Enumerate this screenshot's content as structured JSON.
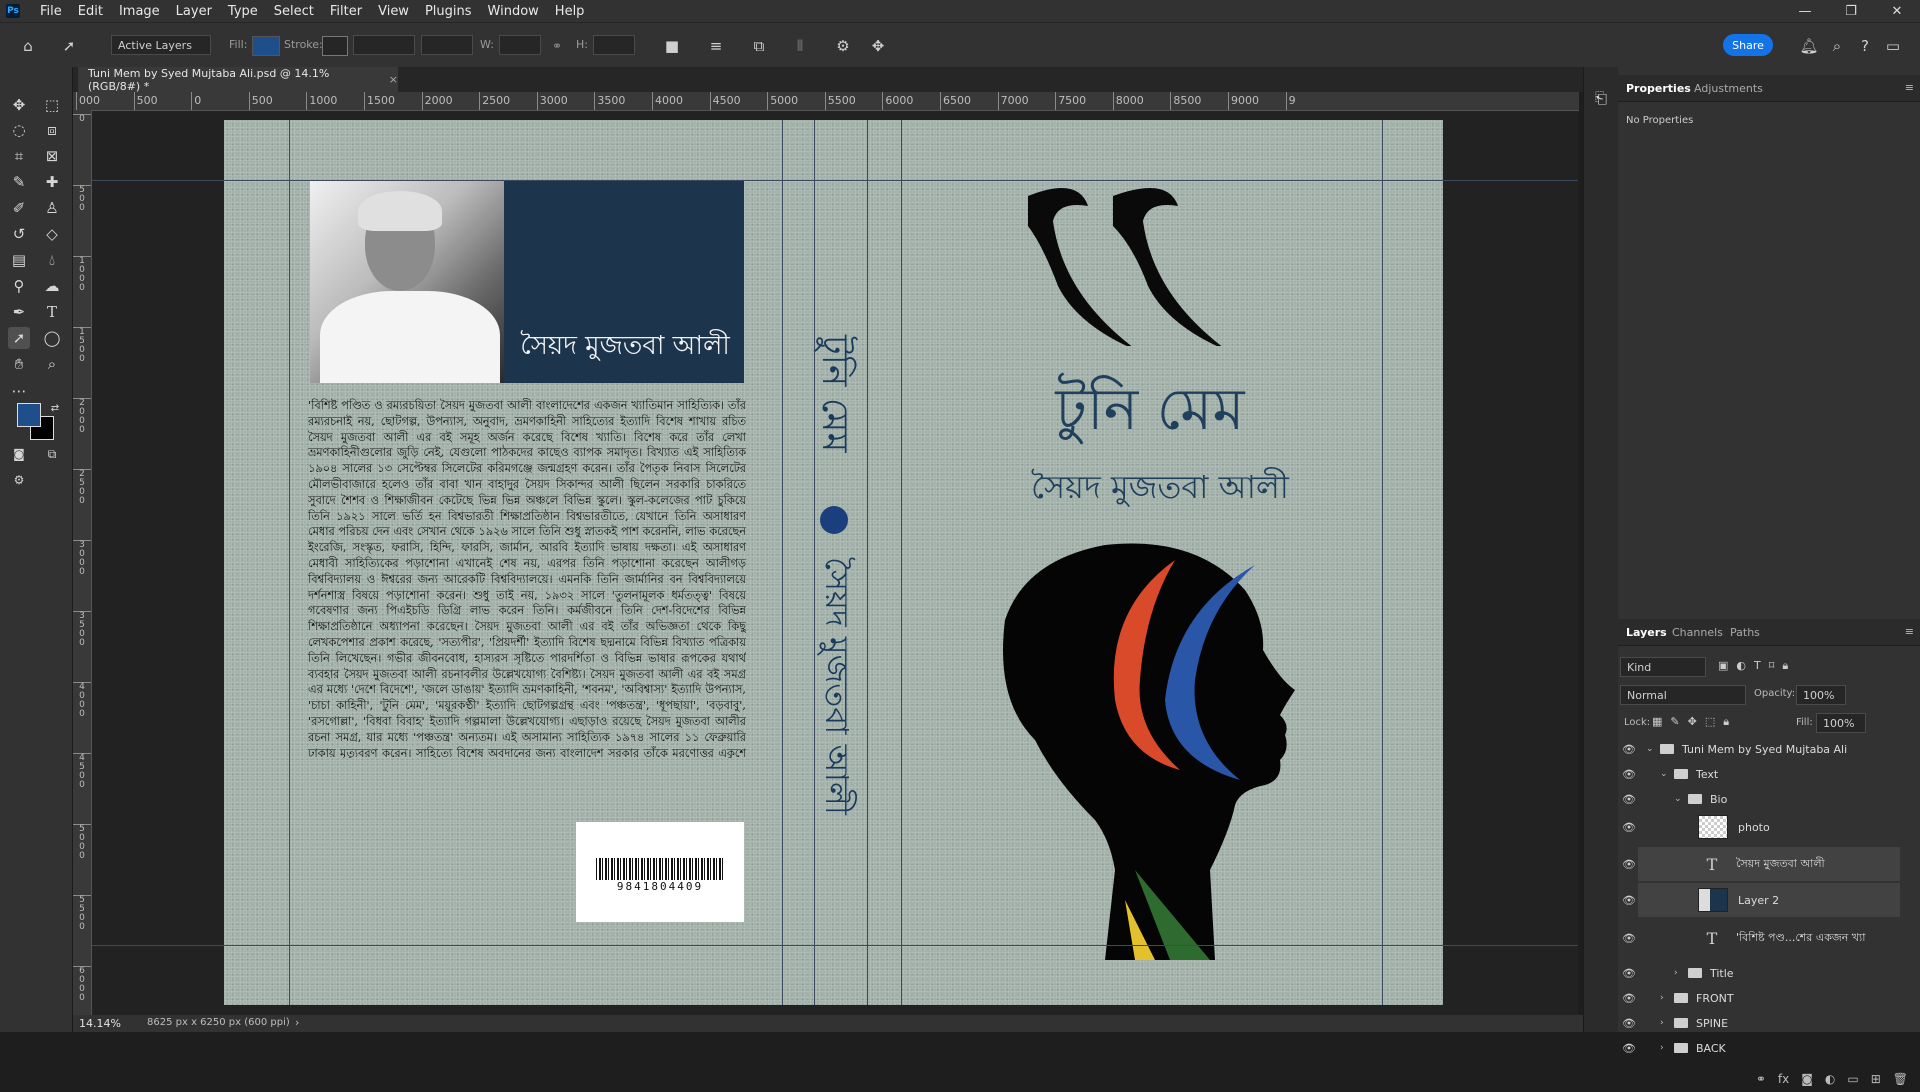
{
  "app": {
    "logo": "Ps"
  },
  "menubar": {
    "items": [
      "File",
      "Edit",
      "Image",
      "Layer",
      "Type",
      "Select",
      "Filter",
      "View",
      "Plugins",
      "Window",
      "Help"
    ]
  },
  "window_controls": {
    "minimize": "—",
    "restore": "❐",
    "close": "✕"
  },
  "optionsbar": {
    "auto_select": "Active Layers",
    "fill_label": "Fill:",
    "stroke_label": "Stroke:",
    "w_label": "W:",
    "h_label": "H:",
    "share_label": "Share"
  },
  "document": {
    "tab_title": "Tuni Mem by Syed Mujtaba Ali.psd @ 14.1% (RGB/8#) *",
    "tab_close": "×",
    "zoom": "14.14%",
    "doc_info": "8625 px x 6250 px (600 ppi)"
  },
  "ruler": {
    "h_labels": [
      "000",
      "500",
      "0",
      "500",
      "1000",
      "1500",
      "2000",
      "2500",
      "3000",
      "3500",
      "4000",
      "4500",
      "5000",
      "5500",
      "6000",
      "6500",
      "7000",
      "7500",
      "8000",
      "8500",
      "9000",
      "9"
    ],
    "v_labels": [
      "0",
      "500",
      "1000",
      "1500",
      "2000",
      "2500",
      "3000",
      "3500",
      "4000",
      "4500",
      "5000",
      "5500",
      "6000"
    ]
  },
  "artwork": {
    "back_author": "সৈয়দ মুজতবা আলী",
    "bio": "'বিশিষ্ট পণ্ডিত ও রম্যরচয়িতা সৈয়দ মুজতবা আলী বাংলাদেশের একজন খ্যাতিমান সাহিত্যিক। তাঁর রম্যরচনাই নয়, ছোটগল্প, উপন্যাস, অনুবাদ, ভ্রমণকাহিনী সাহিত্যের ইত্যাদি বিশেষ শাখায় রচিত সৈয়দ মুজতবা আলী এর বই সমূহ অর্জন করেছে বিশেষ খ্যাতি। বিশেষ করে তাঁর লেখা ভ্রমণকাহিনীগুলোর জুড়ি নেই, যেগুলো পাঠকদের কাছেও ব্যাপক সমাদৃত। বিখ্যাত এই সাহিত্যিক ১৯০৪ সালের ১৩ সেপ্টেম্বর সিলেটের করিমগঞ্জে জন্মগ্রহণ করেন। তাঁর পৈতৃক নিবাস সিলেটের মৌলভীবাজারে হলেও তাঁর বাবা খান বাহাদুর সৈয়দ সিকান্দর আলী ছিলেন সরকারি চাকরিতে সুবাদে শৈশব ও শিক্ষাজীবন কেটেছে ভিন্ন ভিন্ন অঞ্চলে বিভিন্ন স্কুলে। স্কুল-কলেজের পাট চুকিয়ে তিনি ১৯২১ সালে ভর্তি হন বিশ্বভারতী শিক্ষাপ্রতিষ্ঠান বিশ্বভারতীতে, যেখানে তিনি অসাধারণ মেধার পরিচয় দেন এবং সেখান থেকে ১৯২৬ সালে তিনি শুধু স্নাতকই পাশ করেননি, লাভ করেছেন ইংরেজি, সংস্কৃত, ফরাসি, হিন্দি, ফারসি, জার্মান, আরবি ইত্যাদি ভাষায় দক্ষতা। এই অসাধারণ মেধাবী সাহিত্যিকের পড়াশোনা এখানেই শেষ নয়, এরপর তিনি পড়াশোনা করেছেন আলীগড় বিশ্ববিদ্যালয় ও ঈশ্বরের জন্য আরেকটি বিশ্ববিদ্যালয়ে। এমনকি তিনি জার্মানির বন বিশ্ববিদ্যালয়ে দর্শনশাস্ত্র বিষয়ে পড়াশোনা করেন। শুধু তাই নয়, ১৯৩২ সালে 'তুলনামূলক ধর্মতত্ত্ব' বিষয়ে গবেষণার জন্য পিএইচডি ডিগ্রি লাভ করেন তিনি। কর্মজীবনে তিনি দেশ-বিদেশের বিভিন্ন শিক্ষাপ্রতিষ্ঠানে অধ্যাপনা করেছেন। সৈয়দ মুজতবা আলী এর বই তাঁর অভিজ্ঞতা থেকে কিছু লেখকপেশার প্রকাশ করেছে, 'সত্যপীর', 'প্রিয়দর্শী' ইত্যাদি বিশেষ ছদ্মনামে বিভিন্ন বিখ্যাত পত্রিকায় তিনি লিখেছেন। গভীর জীবনবোধ, হাস্যরস সৃষ্টিতে পারদর্শিতা ও বিভিন্ন ভাষার রূপকের যথার্থ ব্যবহার সৈয়দ মুজতবা আলী রচনাবলীর উল্লেখযোগ্য বৈশিষ্ট্য। সৈয়দ মুজতবা আলী এর বই সমগ্র এর মধ্যে 'দেশে বিদেশে', 'জলে ডাঙায়' ইত্যাদি ভ্রমণকাহিনী, 'শবনম', 'অবিশ্বাস্য' ইত্যাদি উপন্যাস, 'চাচা কাহিনী', 'টুনি মেম', 'ময়ূরকণ্ঠী' ইত্যাদি ছোটগল্পগ্রন্থ এবং 'পঞ্চতন্ত্র', 'ধূপছায়া', 'বড়বাবু', 'রসগোল্লা', 'বিধবা বিবাহ' ইত্যাদি গল্পমালা উল্লেখযোগ্য। এছাড়াও রয়েছে সৈয়দ মুজতবা আলীর রচনা সমগ্র, যার মধ্যে 'পঞ্চতন্ত্র' অন্যতম। এই অসামান্য সাহিত্যিক ১৯৭৪ সালের ১১ ফেব্রুয়ারি ঢাকায় মৃত্যুবরণ করেন। সাহিত্যে বিশেষ অবদানের জন্য বাংলাদেশ সরকার তাঁকে মরণোত্তর একুশে পদকে ভূষিত করে",
    "isbn": "9841804409",
    "spine_title": "টুনি মেম",
    "spine_author": "সৈয়দ মুজতবা আলী",
    "front_title": "টুনি মেম",
    "front_author": "সৈয়দ মুজতবা আলী",
    "colors": {
      "cover_bg": "#a2b1a9",
      "navy": "#1c354c",
      "title_blue": "#1f3f5c",
      "red": "#d94a2a",
      "blue": "#2a56a8",
      "green": "#2e6b2e",
      "yellow": "#e3c12c"
    }
  },
  "properties_panel": {
    "tabs": [
      "Properties",
      "Adjustments"
    ],
    "empty_text": "No Properties"
  },
  "layers_panel": {
    "tabs": [
      "Layers",
      "Channels",
      "Paths"
    ],
    "filter_kind": "Kind",
    "blend_mode": "Normal",
    "opacity_label": "Opacity:",
    "opacity": "100%",
    "lock_label": "Lock:",
    "fill_label": "Fill:",
    "fill": "100%",
    "layers": [
      {
        "name": "Tuni Mem by Syed Mujtaba Ali",
        "kind": "group",
        "expanded": true
      },
      {
        "name": "Text",
        "kind": "group",
        "expanded": true
      },
      {
        "name": "Bio",
        "kind": "group",
        "expanded": true
      },
      {
        "name": "photo",
        "kind": "pixel"
      },
      {
        "name": "সৈয়দ মুজতবা আলী",
        "kind": "text",
        "selected": true
      },
      {
        "name": "Layer 2",
        "kind": "pixel",
        "selected": true
      },
      {
        "name": "'বিশিষ্ট পণ্ড...শের একজন খ্যা",
        "kind": "text"
      },
      {
        "name": "Title",
        "kind": "group",
        "expanded": false
      },
      {
        "name": "FRONT",
        "kind": "group",
        "expanded": false
      },
      {
        "name": "SPINE",
        "kind": "group",
        "expanded": false
      },
      {
        "name": "BACK",
        "kind": "group",
        "expanded": false
      }
    ]
  }
}
